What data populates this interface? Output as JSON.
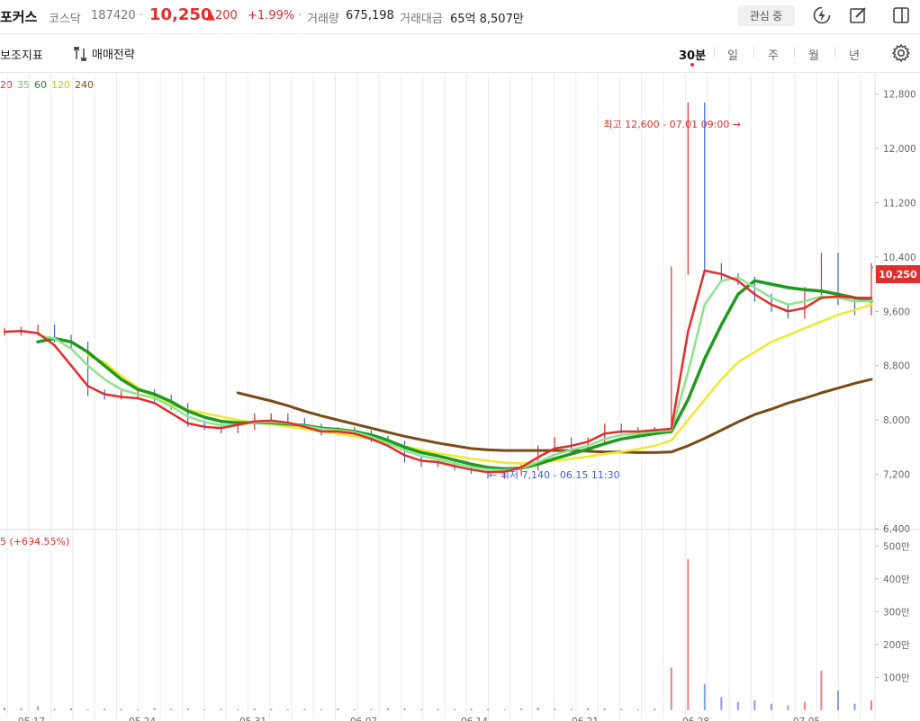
{
  "header": {
    "name": "포커스",
    "market": "코스닥",
    "code": "187420",
    "price": "10,250",
    "change": "▲200",
    "change_pct": "+1.99%",
    "volume_label": "거래량",
    "volume": "675,198",
    "amount_label": "거래대금",
    "amount": "65억 8,507만",
    "watch_button": "관심 중"
  },
  "toolbar": {
    "indicator_label": "보조지표",
    "strategy_label": "매매전략",
    "periods": [
      "30분",
      "일",
      "주",
      "월",
      "년"
    ],
    "active_period": "30분"
  },
  "legend": {
    "ma": [
      {
        "label": "20",
        "color": "#e22d2d"
      },
      {
        "label": "35",
        "color": "#7fe07f"
      },
      {
        "label": "60",
        "color": "#1f9a1f"
      },
      {
        "label": "120",
        "color": "#e7e62e"
      },
      {
        "label": "240",
        "color": "#7a4b14"
      }
    ],
    "volume": "5 (+694.55%)"
  },
  "annotations": {
    "high": "최고 12,600 - 07.01 09:00 →",
    "low": "← 최저 7,140 - 06.15 11:30"
  },
  "current_price_tag": "10,250",
  "colors": {
    "up": "#e22d2d",
    "down": "#3a63d8",
    "ma20": "#e22d2d",
    "ma35": "#8de48d",
    "ma60": "#1f9a1f",
    "ma120": "#ecea30",
    "ma240": "#7a4b14"
  },
  "chart_data": {
    "type": "line",
    "price_ticks": [
      "12,800",
      "12,000",
      "11,200",
      "10,400",
      "9,600",
      "8,800",
      "8,000",
      "7,200",
      "6,400"
    ],
    "price_range": [
      6400,
      13100
    ],
    "volume_ticks": [
      "500만",
      "400만",
      "300만",
      "200만",
      "100만"
    ],
    "volume_range": [
      0,
      520
    ],
    "date_ticks": [
      "05.17",
      "05.24",
      "05.31",
      "06.07",
      "06.14",
      "06.21",
      "06.28",
      "07.05"
    ],
    "close": [
      9300,
      9320,
      9350,
      9200,
      9100,
      8400,
      8350,
      8380,
      8400,
      8320,
      8200,
      7950,
      7900,
      7850,
      7900,
      8050,
      8050,
      7980,
      7900,
      7820,
      7850,
      7800,
      7720,
      7650,
      7420,
      7350,
      7380,
      7300,
      7250,
      7180,
      7220,
      7300,
      7580,
      7700,
      7620,
      7700,
      7900,
      7850,
      7820,
      7850,
      10200,
      12600,
      10250,
      10100,
      10050,
      9800,
      9650,
      9550,
      9900,
      10400,
      9750,
      9600,
      10250
    ],
    "ma20": [
      9300,
      9310,
      9280,
      9100,
      8800,
      8500,
      8380,
      8340,
      8320,
      8250,
      8100,
      7950,
      7900,
      7880,
      7930,
      7980,
      7990,
      7960,
      7900,
      7830,
      7830,
      7800,
      7720,
      7620,
      7480,
      7400,
      7380,
      7320,
      7270,
      7230,
      7240,
      7300,
      7450,
      7580,
      7620,
      7680,
      7800,
      7830,
      7830,
      7850,
      7870,
      9300,
      10200,
      10150,
      10050,
      9850,
      9700,
      9600,
      9650,
      9800,
      9820,
      9800,
      9800
    ],
    "ma35": [
      null,
      null,
      9250,
      9200,
      9050,
      8800,
      8600,
      8450,
      8380,
      8320,
      8200,
      8050,
      7970,
      7920,
      7930,
      7960,
      7970,
      7950,
      7910,
      7870,
      7850,
      7820,
      7750,
      7660,
      7550,
      7470,
      7420,
      7360,
      7310,
      7270,
      7260,
      7290,
      7380,
      7490,
      7560,
      7620,
      7720,
      7780,
      7800,
      7830,
      7850,
      8700,
      9700,
      10050,
      10100,
      9950,
      9800,
      9700,
      9750,
      9820,
      9800,
      9750,
      9750
    ],
    "ma60": [
      null,
      null,
      9150,
      9200,
      9150,
      9000,
      8800,
      8600,
      8450,
      8380,
      8270,
      8130,
      8040,
      7980,
      7960,
      7960,
      7960,
      7940,
      7920,
      7880,
      7860,
      7830,
      7780,
      7700,
      7600,
      7520,
      7470,
      7410,
      7350,
      7300,
      7280,
      7290,
      7350,
      7430,
      7500,
      7570,
      7650,
      7720,
      7760,
      7800,
      7830,
      8300,
      8900,
      9400,
      9850,
      10050,
      10000,
      9950,
      9920,
      9900,
      9850,
      9800,
      9750
    ],
    "ma120": [
      null,
      null,
      null,
      null,
      null,
      8950,
      8850,
      8650,
      8480,
      8330,
      8220,
      8150,
      8100,
      8050,
      8000,
      7960,
      7940,
      7900,
      7870,
      7830,
      7800,
      7760,
      7720,
      7670,
      7610,
      7560,
      7510,
      7470,
      7430,
      7400,
      7370,
      7360,
      7370,
      7400,
      7430,
      7460,
      7500,
      7530,
      7570,
      7620,
      7700,
      8000,
      8300,
      8600,
      8850,
      9000,
      9150,
      9250,
      9350,
      9450,
      9550,
      9620,
      9700
    ],
    "ma240": [
      null,
      null,
      null,
      null,
      null,
      null,
      null,
      null,
      null,
      null,
      null,
      null,
      null,
      null,
      8400,
      8340,
      8280,
      8210,
      8130,
      8060,
      8000,
      7940,
      7880,
      7820,
      7760,
      7710,
      7660,
      7620,
      7580,
      7560,
      7550,
      7550,
      7550,
      7550,
      7550,
      7540,
      7530,
      7530,
      7520,
      7520,
      7530,
      7620,
      7730,
      7850,
      7970,
      8080,
      8160,
      8250,
      8320,
      8400,
      8470,
      8540,
      8600
    ],
    "volume": [
      8,
      5,
      12,
      4,
      6,
      3,
      5,
      4,
      3,
      6,
      4,
      5,
      3,
      4,
      3,
      5,
      4,
      3,
      4,
      3,
      5,
      3,
      4,
      6,
      5,
      3,
      4,
      3,
      5,
      4,
      3,
      6,
      8,
      5,
      4,
      6,
      5,
      4,
      3,
      5,
      130,
      460,
      80,
      40,
      25,
      30,
      20,
      15,
      25,
      120,
      60,
      20,
      30
    ]
  }
}
